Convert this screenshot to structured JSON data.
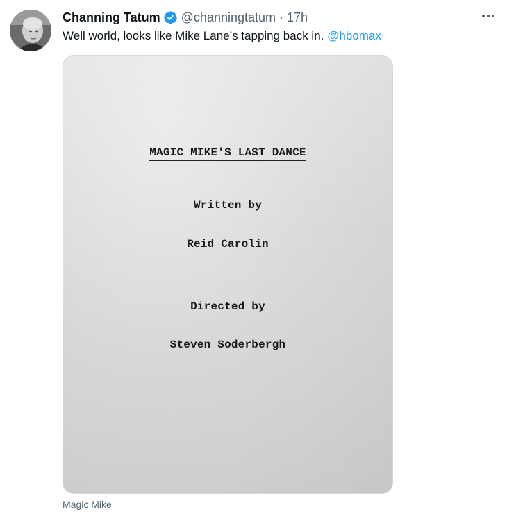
{
  "tweet": {
    "author": {
      "display_name": "Channing Tatum",
      "handle": "@channingtatum",
      "verified": true,
      "avatar": "profile-photo"
    },
    "separator": "·",
    "time": "17h",
    "text_prefix": "Well world, looks like Mike Lane’s tapping back in.",
    "mention": "@hbomax",
    "more_icon": "more-horizontal-icon"
  },
  "media": {
    "script_title": "MAGIC MIKE'S LAST DANCE",
    "written_by_label": "Written by",
    "writer": "Reid Carolin",
    "directed_by_label": "Directed by",
    "director": "Steven Soderbergh"
  },
  "caption": "Magic Mike",
  "colors": {
    "link": "#1d9bf0",
    "secondary_text": "#536471",
    "primary_text": "#0f1419",
    "verified_badge": "#1d9bf0"
  }
}
